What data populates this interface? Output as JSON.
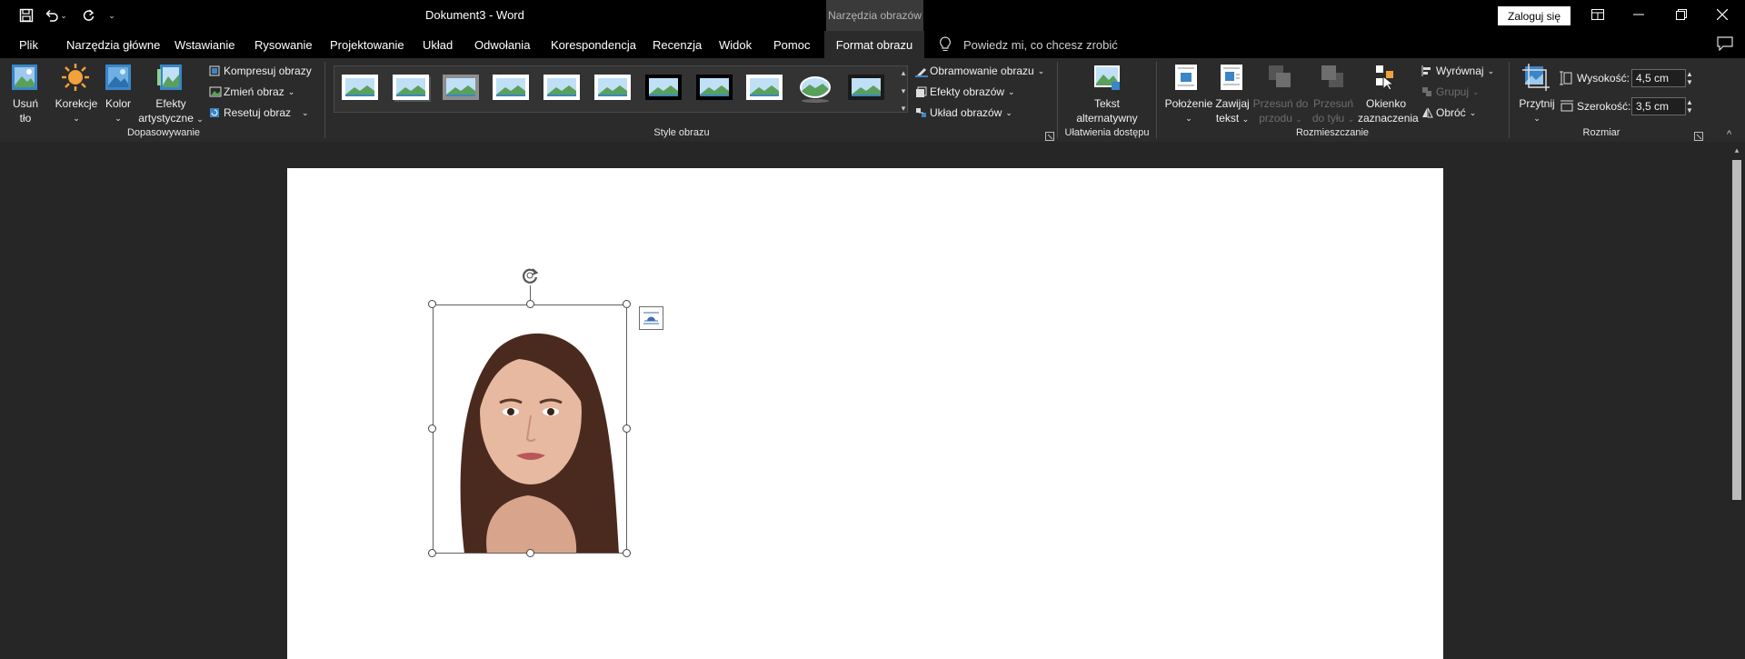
{
  "titlebar": {
    "doc_title": "Dokument3  -  Word",
    "tools_tab": "Narzędzia obrazów",
    "signin": "Zaloguj się",
    "qat_more": "⌄"
  },
  "tabs": [
    "Plik",
    "Narzędzia główne",
    "Wstawianie",
    "Rysowanie",
    "Projektowanie",
    "Układ",
    "Odwołania",
    "Korespondencja",
    "Recenzja",
    "Widok",
    "Pomoc",
    "Format obrazu"
  ],
  "tellme": "Powiedz mi, co chcesz zrobić",
  "ribbon": {
    "adjust": {
      "remove_bg": [
        "Usuń",
        "tło"
      ],
      "corrections": "Korekcje",
      "color": "Kolor",
      "artistic": [
        "Efekty",
        "artystyczne"
      ],
      "compress": "Kompresuj obrazy",
      "change": "Zmień obraz",
      "reset": "Resetuj obraz",
      "group_label": "Dopasowywanie"
    },
    "styles": {
      "border": "Obramowanie obrazu",
      "effects": "Efekty obrazów",
      "layout": "Układ obrazów",
      "group_label": "Style obrazu"
    },
    "access": {
      "alt_text": [
        "Tekst",
        "alternatywny"
      ],
      "group_label": "Ułatwienia dostępu"
    },
    "arrange": {
      "position": "Położenie",
      "wrap": [
        "Zawijaj",
        "tekst"
      ],
      "forward": [
        "Przesuń do",
        "przodu"
      ],
      "backward": [
        "Przesuń",
        "do tyłu"
      ],
      "selection_pane": [
        "Okienko",
        "zaznaczenia"
      ],
      "align": "Wyrównaj",
      "group": "Grupuj",
      "rotate": "Obróć",
      "group_label": "Rozmieszczanie"
    },
    "size": {
      "crop": "Przytnij",
      "height_label": "Wysokość:",
      "height_value": "4,5  cm",
      "width_label": "Szerokość:",
      "width_value": "3,5  cm",
      "group_label": "Rozmiar"
    }
  },
  "colors": {
    "accent": "#3a86c8",
    "ribbon_bg": "#2b2b2b",
    "titlebar_bg": "#000000"
  }
}
